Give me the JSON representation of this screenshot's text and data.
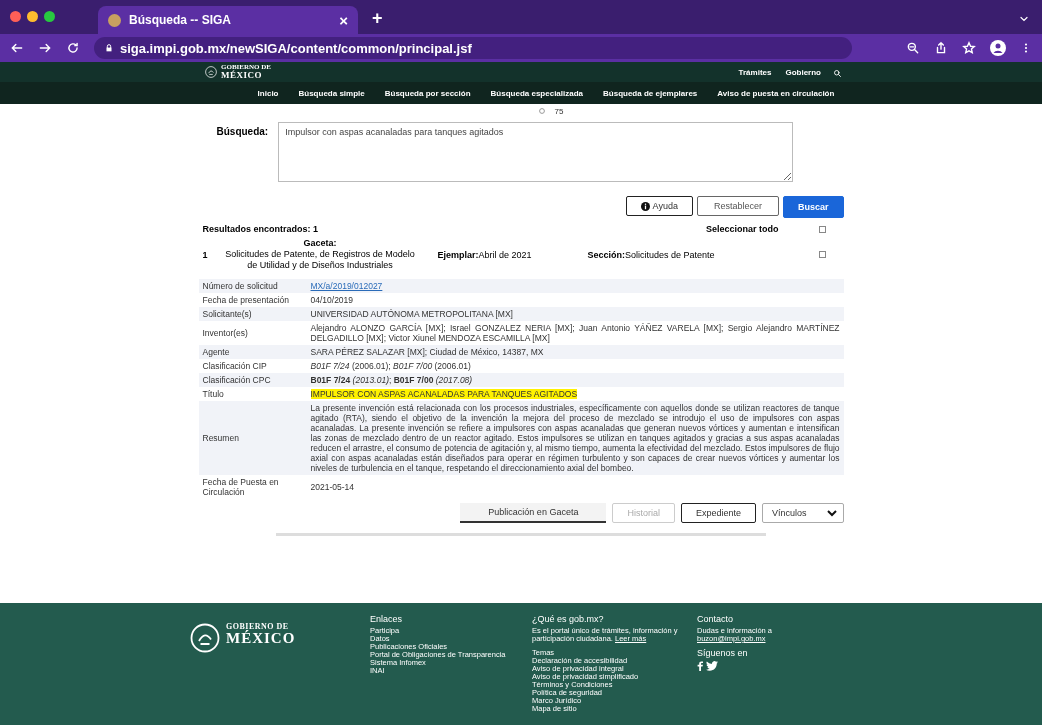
{
  "browser": {
    "tab_title": "Búsqueda -- SIGA",
    "tab_close": "×",
    "new_tab": "+",
    "url": "siga.impi.gob.mx/newSIGA/content/common/principal.jsf"
  },
  "gov_header": {
    "logo_small": "GOBIERNO DE",
    "logo_big": "MÉXICO",
    "links": [
      "Trámites",
      "Gobierno"
    ]
  },
  "nav": {
    "items": [
      "Inicio",
      "Búsqueda simple",
      "Búsqueda por sección",
      "Búsqueda especializada",
      "Búsqueda de ejemplares",
      "Aviso de puesta en circulación"
    ]
  },
  "page_size": {
    "value": "75"
  },
  "search": {
    "label": "Búsqueda:",
    "value": "Impulsor con aspas acanaladas para tanques agitados"
  },
  "actions": [
    {
      "label": "Ayuda",
      "kind": "help"
    },
    {
      "label": "Restablecer",
      "kind": "default"
    },
    {
      "label": "Buscar",
      "kind": "primary"
    }
  ],
  "results": {
    "found": "Resultados encontrados: 1",
    "select_all": {
      "label": "Seleccionar todo",
      "checked": false
    },
    "items": [
      {
        "number": "1",
        "gaceta_label": "Gaceta:",
        "gaceta": "Solicitudes de Patente, de Registros de Modelo de Utilidad y de Diseños Industriales",
        "ejemplar_label": "Ejemplar:",
        "ejemplar": "Abril de 2021",
        "seccion_label": "Sección:",
        "seccion": "Solicitudes de Patente",
        "checked": false
      }
    ]
  },
  "details": [
    {
      "label": "Número de solicitud",
      "value": "MX/a/2019/012027",
      "kind": "link"
    },
    {
      "label": "Fecha de presentación",
      "value": "04/10/2019",
      "kind": "text"
    },
    {
      "label": "Solicitante(s)",
      "value": "UNIVERSIDAD AUTÓNOMA METROPOLITANA [MX]",
      "kind": "text"
    },
    {
      "label": "Inventor(es)",
      "value": "Alejandro ALONZO GARCÍA [MX]; Israel GONZALEZ NERIA [MX]; Juan Antonio YÁÑEZ VARELA [MX]; Sergio Alejandro MARTÍNEZ DELGADILLO [MX]; Victor Xiunel MENDOZA ESCAMILLA [MX]",
      "kind": "text"
    },
    {
      "label": "Agente",
      "value": "SARA PÉREZ SALAZAR [MX]; Ciudad de México, 14387, MX",
      "kind": "text"
    },
    {
      "label": "Clasificación CIP",
      "value": "*B01F 7/24* (2006.01); *B01F 7/00* (2006.01)",
      "kind": "rich"
    },
    {
      "label": "Clasificación CPC",
      "value": "**B01F 7/24** *(2013.01)*; **B01F 7/00** *(2017.08)*",
      "kind": "rich"
    },
    {
      "label": "Título",
      "value": "IMPULSOR CON ASPAS ACANALADAS PARA TANQUES AGITADOS",
      "kind": "highlight"
    },
    {
      "label": "Resumen",
      "value": "La presente invención está relacionada con los procesos industriales, específicamente con aquellos donde se utilizan reactores de tanque agitado (RTA), siendo el objetivo de la invención la mejora del proceso de mezclado se introdujo el uso de impulsores con aspas acanaladas. La presente invención se refiere a impulsores con aspas acanaladas que generan nuevos vórtices y aumentan e intensifican las zonas de mezclado dentro de un reactor agitado. Estos impulsores se utilizan en tanques agitados y gracias a sus aspas acanaladas reducen el arrastre, el consumo de potencia de agitación y, al mismo tiempo, aumenta la efectividad del mezclado. Estos impulsores de flujo axial con aspas acanaladas están diseñados para operar en régimen turbulento y son capaces de crear nuevos vórtices y aumentar los niveles de turbulencia en el tanque, respetando el direccionamiento axial del bombeo.",
      "kind": "paragraph"
    },
    {
      "label": "Fecha de Puesta en Circulación",
      "value": "2021-05-14",
      "kind": "plain"
    }
  ],
  "record_actions": [
    {
      "label": "Publicación en Gaceta",
      "kind": "tab",
      "disabled": false
    },
    {
      "label": "Historial",
      "kind": "outline",
      "disabled": true
    },
    {
      "label": "Expediente",
      "kind": "outline",
      "disabled": false
    },
    {
      "label": "Vínculos",
      "kind": "dropdown",
      "disabled": false
    }
  ],
  "footer": {
    "logo_small": "GOBIERNO DE",
    "logo_big": "MÉXICO",
    "enlaces": {
      "title": "Enlaces",
      "items": [
        "Participa",
        "Datos",
        "Publicaciones Oficiales",
        "Portal de Obligaciones de Transparencia",
        "Sistema Infomex",
        "INAI"
      ]
    },
    "que_es": {
      "title": "¿Qué es gob.mx?",
      "text": "Es el portal único de trámites, información y participación ciudadana.",
      "link": "Leer más",
      "temas_title": "Temas",
      "temas": [
        "Declaración de accesibilidad",
        "Aviso de privacidad integral",
        "Aviso de privacidad simplificado",
        "Términos y Condiciones",
        "Política de seguridad",
        "Marco Jurídico",
        "Mapa de sitio"
      ]
    },
    "contacto": {
      "title": "Contacto",
      "text": "Dudas e información a",
      "email": "buzon@impi.gob.mx",
      "follow": "Síguenos en"
    }
  }
}
